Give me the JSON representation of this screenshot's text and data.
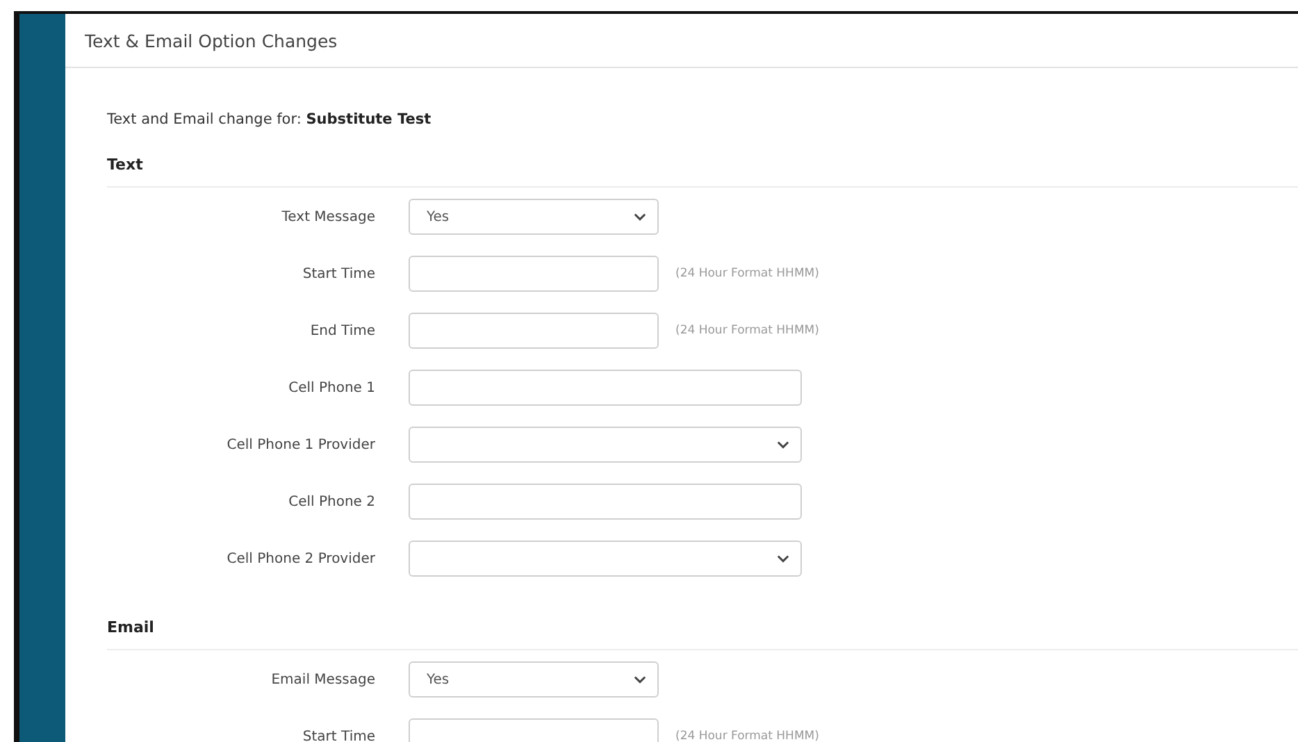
{
  "panel": {
    "title": "Text & Email Option Changes"
  },
  "intro": "Text and Email change for: **Substitute Test**",
  "sections": [
    {
      "title": "Text",
      "fields": [
        {
          "label": "Text Message",
          "kind": "yes-no",
          "value": "Yes"
        },
        {
          "label": "Start Time",
          "kind": "time",
          "hint": "(24 Hour Format HHMM)"
        },
        {
          "label": "End Time",
          "kind": "time",
          "hint": "(24 Hour Format HHMM)"
        },
        {
          "label": "Cell Phone 1",
          "kind": "text"
        },
        {
          "label": "Cell Phone 1 Provider",
          "kind": "select"
        },
        {
          "label": "Cell Phone 2",
          "kind": "text"
        },
        {
          "label": "Cell Phone 2 Provider",
          "kind": "select"
        }
      ]
    },
    {
      "title": "Email",
      "fields": [
        {
          "label": "Email Message",
          "kind": "yes-no",
          "value": "Yes"
        },
        {
          "label": "Start Time",
          "kind": "time",
          "hint": "(24 Hour Format HHMM)"
        }
      ]
    }
  ]
}
